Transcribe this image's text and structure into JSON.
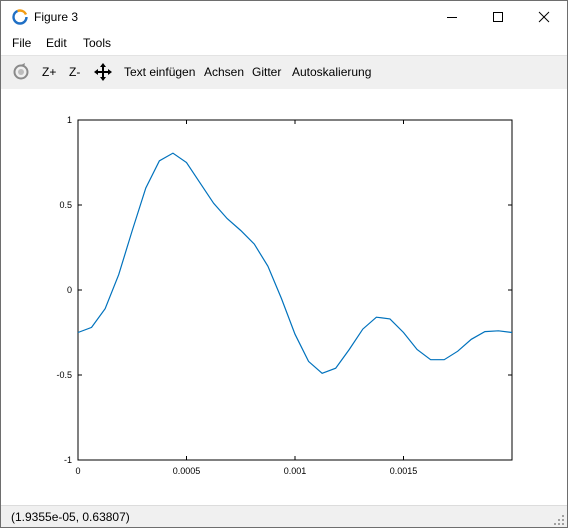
{
  "window": {
    "title": "Figure 3",
    "controls": {
      "minimize": "minimize",
      "maximize": "maximize",
      "close": "close"
    }
  },
  "menu": [
    "File",
    "Edit",
    "Tools"
  ],
  "toolbar": {
    "rotate_icon": "rotate-icon",
    "zoom_in": "Z+",
    "zoom_out": "Z-",
    "pan_icon": "pan-move-icon",
    "insert_text": "Text einfügen",
    "axes": "Achsen",
    "grid": "Gitter",
    "autoscale": "Autoskalierung"
  },
  "status": {
    "coordinates": "(1.9355e-05, 0.63807)"
  },
  "colors": {
    "line": "#0072bd",
    "toolbar_bg": "#f0f0f0"
  },
  "chart_data": {
    "type": "line",
    "xlim": [
      0,
      0.002
    ],
    "ylim": [
      -1,
      1
    ],
    "xticks": [
      0,
      0.0005,
      0.001,
      0.0015
    ],
    "xtick_labels": [
      "0",
      "0.0005",
      "0.001",
      "0.0015"
    ],
    "yticks": [
      -1,
      -0.5,
      0,
      0.5,
      1
    ],
    "ytick_labels": [
      "-1",
      "-0.5",
      "0",
      "0.5",
      "1"
    ],
    "grid": false,
    "series": [
      {
        "x": [
          0,
          6.25e-05,
          0.000125,
          0.0001875,
          0.00025,
          0.0003125,
          0.000375,
          0.0004375,
          0.0005,
          0.0005625,
          0.000625,
          0.0006875,
          0.00075,
          0.0008125,
          0.000875,
          0.0009375,
          0.001,
          0.0010625,
          0.001125,
          0.0011875,
          0.00125,
          0.0013125,
          0.001375,
          0.0014375,
          0.0015,
          0.0015625,
          0.001625,
          0.0016875,
          0.00175,
          0.0018125,
          0.001875,
          0.0019375,
          0.002
        ],
        "values": [
          -0.25,
          -0.22,
          -0.11,
          0.09,
          0.35,
          0.6,
          0.76,
          0.805,
          0.75,
          0.63,
          0.51,
          0.42,
          0.35,
          0.27,
          0.14,
          -0.05,
          -0.26,
          -0.42,
          -0.49,
          -0.46,
          -0.35,
          -0.23,
          -0.16,
          -0.17,
          -0.25,
          -0.35,
          -0.41,
          -0.41,
          -0.36,
          -0.29,
          -0.245,
          -0.24,
          -0.25
        ]
      }
    ]
  }
}
